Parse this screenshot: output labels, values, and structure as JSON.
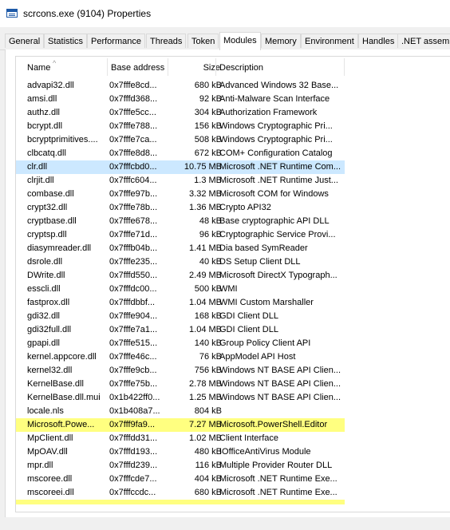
{
  "window": {
    "title": "scrcons.exe (9104) Properties"
  },
  "tabs": [
    "General",
    "Statistics",
    "Performance",
    "Threads",
    "Token",
    "Modules",
    "Memory",
    "Environment",
    "Handles",
    ".NET assemb"
  ],
  "active_tab": "Modules",
  "columns": {
    "name": "Name",
    "base": "Base address",
    "size": "Size",
    "desc": "Description"
  },
  "colors": {
    "selected_row": "#cce8ff",
    "highlight_row": "#ffff80"
  },
  "modules": [
    {
      "name": "advapi32.dll",
      "base": "0x7fffe8cd...",
      "size": "680 kB",
      "desc": "Advanced Windows 32 Base..."
    },
    {
      "name": "amsi.dll",
      "base": "0x7fffd368...",
      "size": "92 kB",
      "desc": "Anti-Malware Scan Interface"
    },
    {
      "name": "authz.dll",
      "base": "0x7fffe5cc...",
      "size": "304 kB",
      "desc": "Authorization Framework"
    },
    {
      "name": "bcrypt.dll",
      "base": "0x7fffe788...",
      "size": "156 kB",
      "desc": "Windows Cryptographic Pri..."
    },
    {
      "name": "bcryptprimitives....",
      "base": "0x7fffe7ca...",
      "size": "508 kB",
      "desc": "Windows Cryptographic Pri..."
    },
    {
      "name": "clbcatq.dll",
      "base": "0x7fffe8d8...",
      "size": "672 kB",
      "desc": "COM+ Configuration Catalog"
    },
    {
      "name": "clr.dll",
      "base": "0x7fffcbd0...",
      "size": "10.75 MB",
      "desc": "Microsoft .NET Runtime Com...",
      "state": "sel"
    },
    {
      "name": "clrjit.dll",
      "base": "0x7fffc604...",
      "size": "1.3 MB",
      "desc": "Microsoft .NET Runtime Just..."
    },
    {
      "name": "combase.dll",
      "base": "0x7fffe97b...",
      "size": "3.32 MB",
      "desc": "Microsoft COM for Windows"
    },
    {
      "name": "crypt32.dll",
      "base": "0x7fffe78b...",
      "size": "1.36 MB",
      "desc": "Crypto API32"
    },
    {
      "name": "cryptbase.dll",
      "base": "0x7fffe678...",
      "size": "48 kB",
      "desc": "Base cryptographic API DLL"
    },
    {
      "name": "cryptsp.dll",
      "base": "0x7fffe71d...",
      "size": "96 kB",
      "desc": "Cryptographic Service Provi..."
    },
    {
      "name": "diasymreader.dll",
      "base": "0x7fffb04b...",
      "size": "1.41 MB",
      "desc": "Dia based SymReader"
    },
    {
      "name": "dsrole.dll",
      "base": "0x7fffe235...",
      "size": "40 kB",
      "desc": "DS Setup Client DLL"
    },
    {
      "name": "DWrite.dll",
      "base": "0x7fffd550...",
      "size": "2.49 MB",
      "desc": "Microsoft DirectX Typograph..."
    },
    {
      "name": "esscli.dll",
      "base": "0x7fffdc00...",
      "size": "500 kB",
      "desc": "WMI"
    },
    {
      "name": "fastprox.dll",
      "base": "0x7fffdbbf...",
      "size": "1.04 MB",
      "desc": "WMI Custom Marshaller"
    },
    {
      "name": "gdi32.dll",
      "base": "0x7fffe904...",
      "size": "168 kB",
      "desc": "GDI Client DLL"
    },
    {
      "name": "gdi32full.dll",
      "base": "0x7fffe7a1...",
      "size": "1.04 MB",
      "desc": "GDI Client DLL"
    },
    {
      "name": "gpapi.dll",
      "base": "0x7fffe515...",
      "size": "140 kB",
      "desc": "Group Policy Client API"
    },
    {
      "name": "kernel.appcore.dll",
      "base": "0x7fffe46c...",
      "size": "76 kB",
      "desc": "AppModel API Host"
    },
    {
      "name": "kernel32.dll",
      "base": "0x7fffe9cb...",
      "size": "756 kB",
      "desc": "Windows NT BASE API Clien..."
    },
    {
      "name": "KernelBase.dll",
      "base": "0x7fffe75b...",
      "size": "2.78 MB",
      "desc": "Windows NT BASE API Clien..."
    },
    {
      "name": "KernelBase.dll.mui",
      "base": "0x1b422ff0...",
      "size": "1.25 MB",
      "desc": "Windows NT BASE API Clien..."
    },
    {
      "name": "locale.nls",
      "base": "0x1b408a7...",
      "size": "804 kB",
      "desc": ""
    },
    {
      "name": "Microsoft.Powe...",
      "base": "0x7fff9fa9...",
      "size": "7.27 MB",
      "desc": "Microsoft.PowerShell.Editor",
      "state": "hl"
    },
    {
      "name": "MpClient.dll",
      "base": "0x7fffdd31...",
      "size": "1.02 MB",
      "desc": "Client Interface"
    },
    {
      "name": "MpOAV.dll",
      "base": "0x7fffd193...",
      "size": "480 kB",
      "desc": "IOfficeAntiVirus Module"
    },
    {
      "name": "mpr.dll",
      "base": "0x7fffd239...",
      "size": "116 kB",
      "desc": "Multiple Provider Router DLL"
    },
    {
      "name": "mscoree.dll",
      "base": "0x7fffcde7...",
      "size": "404 kB",
      "desc": "Microsoft .NET Runtime Exe..."
    },
    {
      "name": "mscoreei.dll",
      "base": "0x7fffccdc...",
      "size": "680 kB",
      "desc": "Microsoft .NET Runtime Exe..."
    }
  ]
}
